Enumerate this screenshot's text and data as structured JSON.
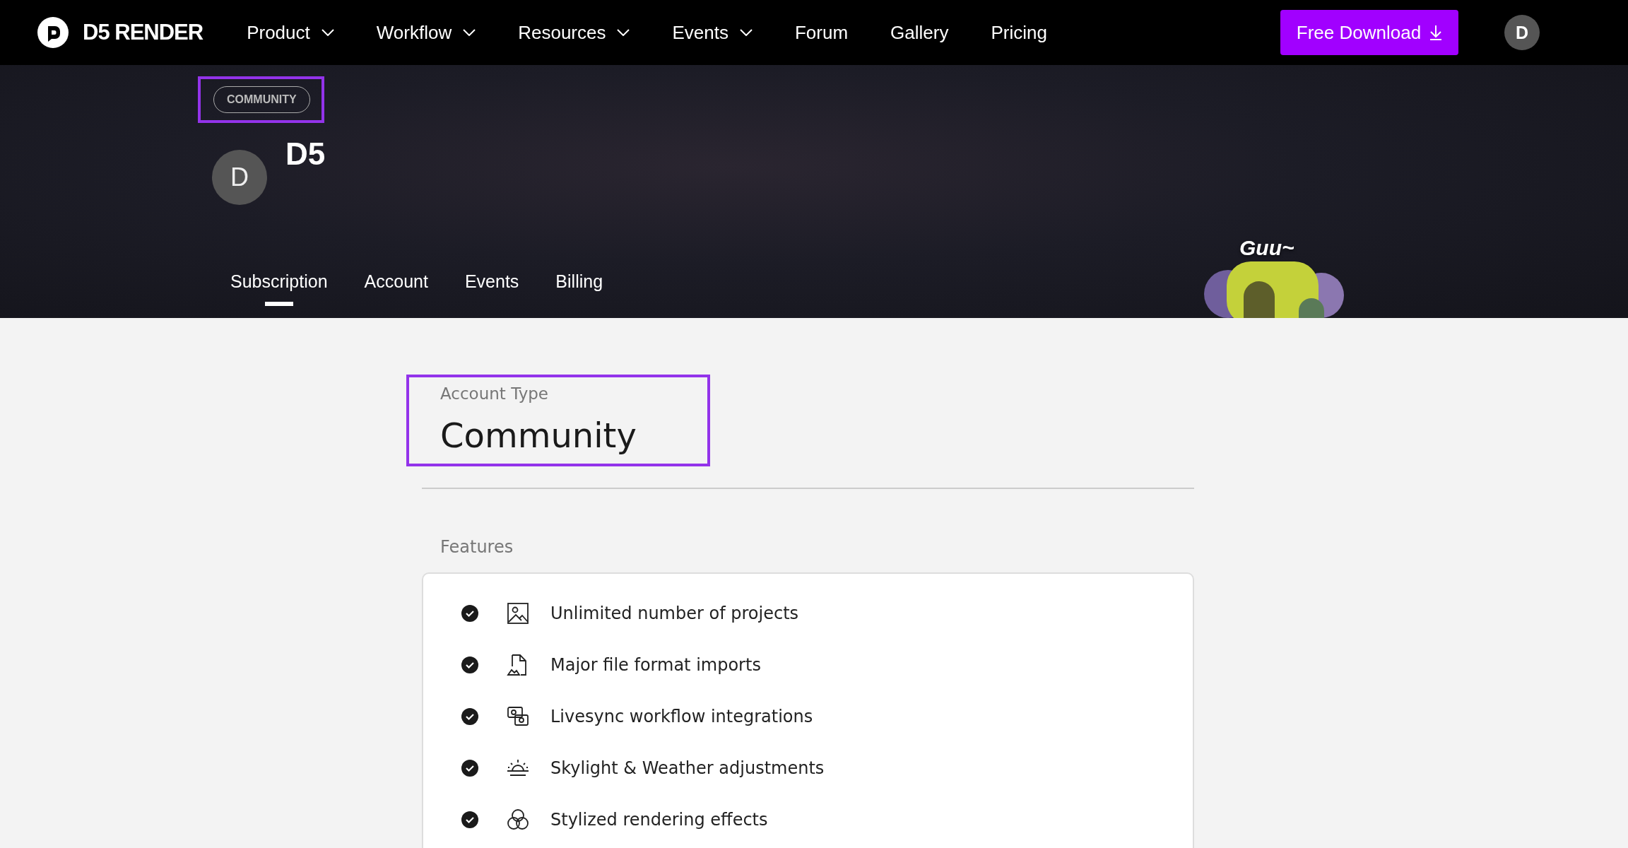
{
  "nav": {
    "logo": "D5 RENDER",
    "items": [
      {
        "label": "Product",
        "dropdown": true
      },
      {
        "label": "Workflow",
        "dropdown": true
      },
      {
        "label": "Resources",
        "dropdown": true
      },
      {
        "label": "Events",
        "dropdown": true
      },
      {
        "label": "Forum",
        "dropdown": false
      },
      {
        "label": "Gallery",
        "dropdown": false
      },
      {
        "label": "Pricing",
        "dropdown": false
      }
    ],
    "cta": "Free Download",
    "avatar": "D"
  },
  "profile": {
    "badge": "COMMUNITY",
    "badge_highlighted": true,
    "avatar": "D",
    "name": "D5",
    "tabs": [
      {
        "label": "Subscription",
        "selected": true
      },
      {
        "label": "Account",
        "selected": false
      },
      {
        "label": "Events",
        "selected": false
      },
      {
        "label": "Billing",
        "selected": false
      }
    ],
    "mascot_caption": "Guu~"
  },
  "account": {
    "label": "Account Type",
    "value": "Community",
    "highlighted": true
  },
  "features": {
    "heading": "Features",
    "items": [
      {
        "text": "Unlimited number of projects",
        "checked": true,
        "kind": "image"
      },
      {
        "text": "Major file format imports",
        "checked": true,
        "kind": "file"
      },
      {
        "text": "Livesync workflow integrations",
        "checked": true,
        "kind": "sync"
      },
      {
        "text": "Skylight & Weather adjustments",
        "checked": true,
        "kind": "sunrise"
      },
      {
        "text": "Stylized rendering effects",
        "checked": true,
        "kind": "circles"
      }
    ]
  }
}
